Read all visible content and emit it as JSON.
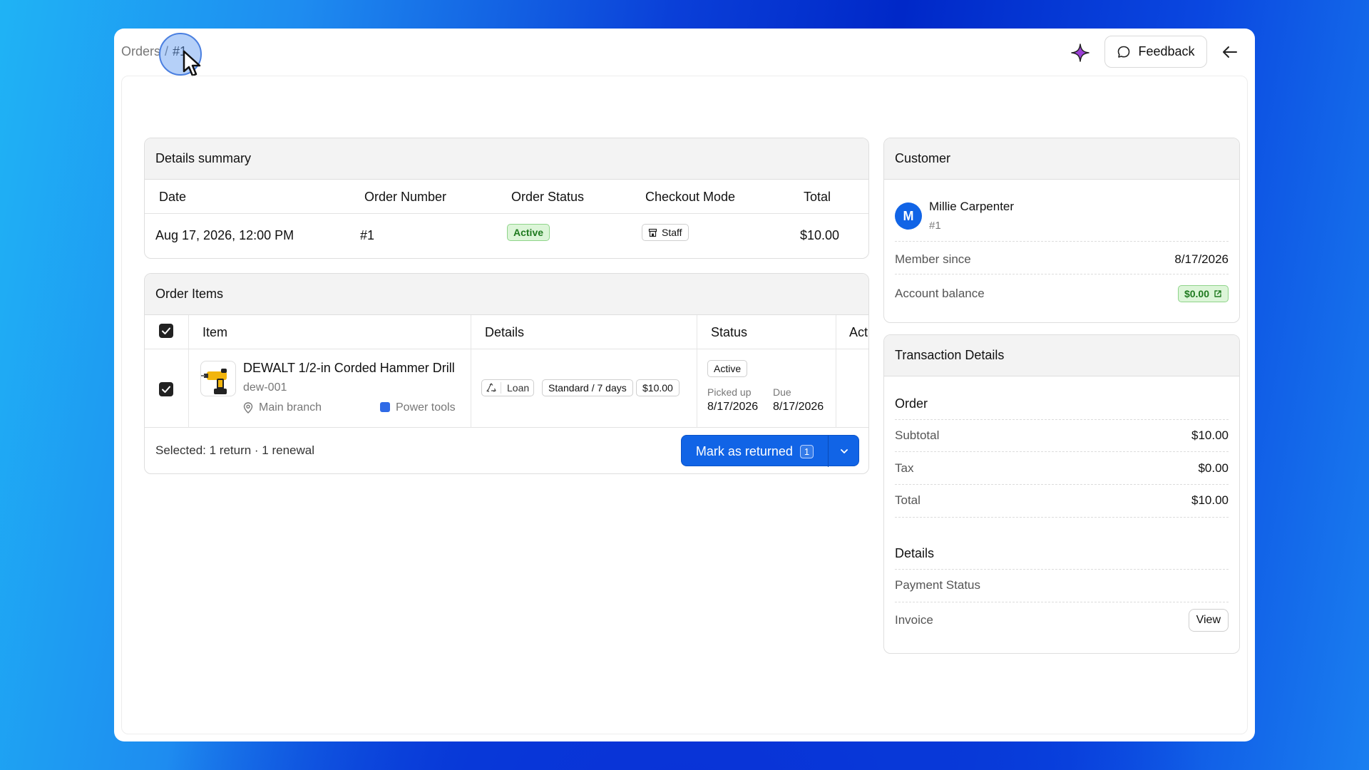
{
  "breadcrumb": {
    "root": "Orders",
    "separator": "/",
    "current": "#1"
  },
  "header": {
    "feedback_label": "Feedback"
  },
  "details_summary": {
    "title": "Details summary",
    "columns": [
      "Date",
      "Order Number",
      "Order Status",
      "Checkout Mode",
      "Total"
    ],
    "row": {
      "date": "Aug 17, 2026, 12:00 PM",
      "order_number": "#1",
      "order_status": "Active",
      "checkout_mode": "Staff",
      "total": "$10.00"
    }
  },
  "order_items": {
    "title": "Order Items",
    "columns": [
      "Item",
      "Details",
      "Status",
      "Act"
    ],
    "rows": [
      {
        "name": "DEWALT 1/2-in Corded Hammer Drill",
        "sku": "dew-001",
        "location": "Main branch",
        "category": "Power tools",
        "detail_type": "Loan",
        "detail_plan": "Standard / 7 days",
        "detail_price": "$10.00",
        "status": "Active",
        "picked_up_label": "Picked up",
        "picked_up_date": "8/17/2026",
        "due_label": "Due",
        "due_date": "8/17/2026"
      }
    ],
    "footer": {
      "selection_text": "Selected: 1 return · 1 renewal",
      "primary_label": "Mark as returned",
      "primary_count": "1"
    }
  },
  "customer": {
    "title": "Customer",
    "avatar_initial": "M",
    "name": "Millie Carpenter",
    "id": "#1",
    "member_since_label": "Member since",
    "member_since_value": "8/17/2026",
    "balance_label": "Account balance",
    "balance_value": "$0.00"
  },
  "transaction": {
    "title": "Transaction Details",
    "order_section": "Order",
    "subtotal_label": "Subtotal",
    "subtotal_value": "$10.00",
    "tax_label": "Tax",
    "tax_value": "$0.00",
    "total_label": "Total",
    "total_value": "$10.00",
    "details_section": "Details",
    "payment_status_label": "Payment Status",
    "invoice_label": "Invoice",
    "view_label": "View"
  },
  "colors": {
    "accent": "#1164e6",
    "success_bg": "#dcf5d8",
    "success_text": "#1f7a1f",
    "sparkle": "#9b3fd6"
  }
}
